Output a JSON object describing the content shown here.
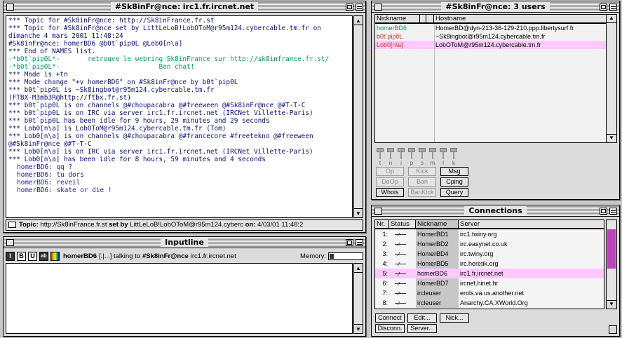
{
  "channel_window": {
    "title": "#Sk8inFr@nce: irc1.fr.ircnet.net",
    "log_lines": [
      {
        "text": "*** Topic for #Sk8inFr@nce: http://Sk8inFrance.fr.st",
        "style": ""
      },
      {
        "text": "*** Topic for #Sk8inFr@nce set by LittLeLoB!LobOToM@r95m124.cybercable.tm.fr on",
        "style": ""
      },
      {
        "text": "dimanche 4 mars 2001 11:48:24",
        "style": ""
      },
      {
        "text": "#Sk8inFr@nce: homerBD6 @b0t`pip0L @Lob0[n\\a]",
        "style": ""
      },
      {
        "text": "*** End of NAMES list.",
        "style": ""
      },
      {
        "text": "-*b0t`pip0L*-       retrouve le webring Sk8inFrance sur http://sk8infrance.fr.st/",
        "style": "green"
      },
      {
        "text": "-*b0t`pip0L*-                         Bon chat!",
        "style": "green"
      },
      {
        "text": "*** Mode is +tn",
        "style": ""
      },
      {
        "text": "*** Mode change \"+v homerBD6\" on #Sk8inFr@nce by b0t`pip0L",
        "style": ""
      },
      {
        "text": "*** b0t`pip0L is ~Sk8ingbot@r95m124.cybercable.tm.fr",
        "style": ""
      },
      {
        "text": "(FTBX-M3mb3R@http://ftbx.fr.st)",
        "style": ""
      },
      {
        "text": "*** b0t`pip0L is on channels @#choupacabra @#freeween @#Sk8inFr@nce @#T-T-C",
        "style": ""
      },
      {
        "text": "*** b0t`pip0L is on IRC via server irc1.fr.ircnet.net (IRCNet Villette-Paris)",
        "style": ""
      },
      {
        "text": "*** b0t`pip0L has been idle for 9 hours, 29 minutes and 29 seconds",
        "style": ""
      },
      {
        "text": "*** Lob0[n\\a] is LobOToM@r95m124.cybercable.tm.fr (Tom)",
        "style": ""
      },
      {
        "text": "*** Lob0[n\\a] is on channels @#choupacabra @#francecore #freetekno @#freeween",
        "style": ""
      },
      {
        "text": "@#Sk8inFr@nce @#T-T-C",
        "style": ""
      },
      {
        "text": "*** Lob0[n\\a] is on IRC via server irc1.fr.ircnet.net (IRCNet Villette-Paris)",
        "style": ""
      },
      {
        "text": "*** Lob0[n\\a] has been idle for 8 hours, 59 minutes and 4 seconds",
        "style": ""
      },
      {
        "text": "homerBD6: qq ?",
        "style": "indent"
      },
      {
        "text": "homerBD6: tu dors",
        "style": "indent"
      },
      {
        "text": "homerBD6: reveil",
        "style": "indent"
      },
      {
        "text": "homerBD6: skate or die !",
        "style": "indent"
      }
    ],
    "topic_bar": {
      "topic_label": "Topic:",
      "topic_value": "http://Sk8inFrance.fr.st",
      "setby_label": "set by",
      "setby_value": "LittLeLoB!LobOToM@r95m124.cyberc",
      "on_label": "on:",
      "on_value": "4/03/01 11:48:2"
    }
  },
  "inputline_window": {
    "title": "Inputline",
    "format_buttons": [
      "I",
      "B",
      "U",
      "ab"
    ],
    "nick": "homerBD6",
    "talking_prefix": "[.|...] talking to",
    "channel": "#Sk8inFr@nce",
    "server": "irc1.fr.ircnet.net",
    "memory_label": "Memory:",
    "input_value": ""
  },
  "users_window": {
    "title": "#Sk8inFr@nce: 3 users",
    "headers": {
      "nickname": "Nickname",
      "hostname": "Hostname"
    },
    "users": [
      {
        "nick": "homerBD6",
        "host": "HomerBD@dyn-213-36-129-210.ppp.libertysurf.fr",
        "color": "#00a060",
        "selected": false
      },
      {
        "nick": "b0t`pip0L",
        "host": "~Sk8ingbot@r95m124.cybercable.tm.fr",
        "color": "#e0301e",
        "selected": false
      },
      {
        "nick": "Lob0[n\\a]",
        "host": "LobOToM@r95m124.cybercable.tm.fr",
        "color": "#e0301e",
        "selected": true
      }
    ],
    "mode_letters": [
      "t",
      "n",
      "i",
      "p",
      "s",
      "m",
      "l",
      "k"
    ],
    "buttons": [
      {
        "label": "Op",
        "enabled": false
      },
      {
        "label": "Kick",
        "enabled": false
      },
      {
        "label": "Msg",
        "enabled": true
      },
      {
        "label": "DeOp",
        "enabled": false
      },
      {
        "label": "Ban",
        "enabled": false
      },
      {
        "label": "Cping",
        "enabled": true
      },
      {
        "label": "Whois",
        "enabled": true
      },
      {
        "label": "BanKick",
        "enabled": false
      },
      {
        "label": "Query",
        "enabled": true
      }
    ]
  },
  "connections_window": {
    "title": "Connections",
    "headers": {
      "nr": "Nr.",
      "status": "Status",
      "nickname": "Nickname",
      "server": "Server"
    },
    "rows": [
      {
        "nr": "1:",
        "nick": "HomerBD1",
        "server": "irc1.twiny.org",
        "selected": false
      },
      {
        "nr": "2:",
        "nick": "HomerBD2",
        "server": "irc.easynet.co.uk",
        "selected": false
      },
      {
        "nr": "3:",
        "nick": "HomerBD4",
        "server": "irc.twiny.org",
        "selected": false
      },
      {
        "nr": "4:",
        "nick": "HomerBD5",
        "server": "irc.heretik.org",
        "selected": false
      },
      {
        "nr": "5:",
        "nick": "homerBD6",
        "server": "irc1.fr.ircnet.net",
        "selected": true
      },
      {
        "nr": "6:",
        "nick": "HomerBD7",
        "server": "ircnet.hinet.hr",
        "selected": false
      },
      {
        "nr": "7:",
        "nick": "ircleuser",
        "server": "erols.va.us.another.net",
        "selected": false
      },
      {
        "nr": "8:",
        "nick": "ircleuser",
        "server": "Anarchy.CA.XWorld.Org",
        "selected": false
      }
    ],
    "buttons": {
      "connect": "Connect",
      "edit": "Edit...",
      "nick": "Nick...",
      "disconn": "Disconn.",
      "server": "Server..."
    },
    "colors": {
      "selection": "#ffc8ff",
      "scroll_thumb": "#c040c0"
    }
  }
}
